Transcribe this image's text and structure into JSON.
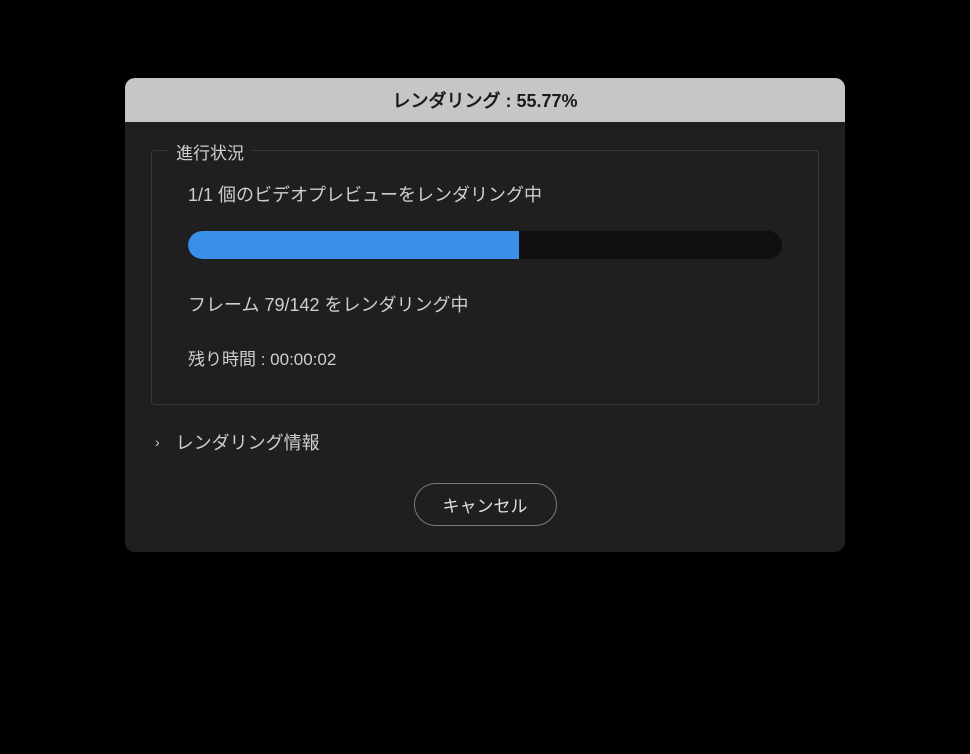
{
  "title": "レンダリング : 55.77%",
  "progress": {
    "legend": "進行状況",
    "status": "1/1 個のビデオプレビューをレンダリング中",
    "percent": 55.77,
    "frame_text": "フレーム 79/142 をレンダリング中",
    "time_text": "残り時間 : 00:00:02"
  },
  "expand": {
    "label": "レンダリング情報"
  },
  "buttons": {
    "cancel": "キャンセル"
  }
}
